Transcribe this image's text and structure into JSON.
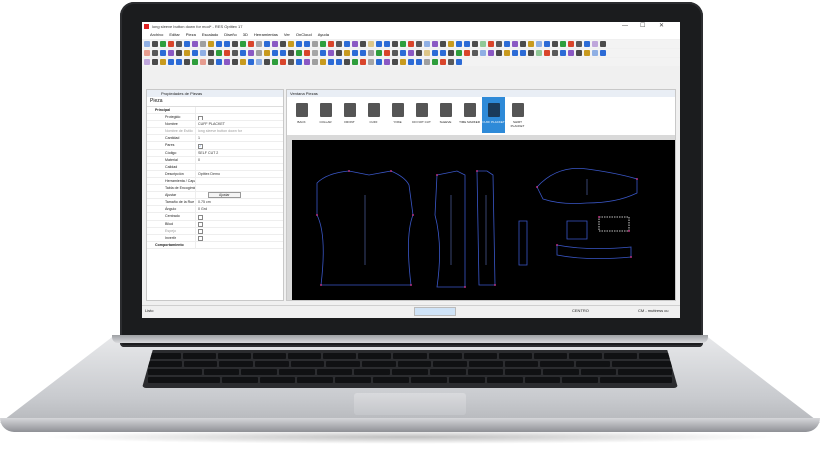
{
  "window": {
    "title": "long sleeve button down for mod* - RES Optitex 17",
    "controls": [
      "—",
      "☐",
      "✕"
    ]
  },
  "menu": [
    "Archivo",
    "Editar",
    "Pieza",
    "Escalado",
    "Diseño",
    "3D",
    "Herramientas",
    "Ver",
    "OnCloud",
    "Ayuda"
  ],
  "left_panel": {
    "title": "Propiedades de Piezas",
    "subtitle": "Pieza",
    "properties": [
      {
        "k": "Principal",
        "v": "",
        "section": true
      },
      {
        "k": "Protegido",
        "v": "",
        "type": "check"
      },
      {
        "k": "Nombre",
        "v": "CUFF PLACKET"
      },
      {
        "k": "Nombre de Estilo",
        "v": "long sleeve button down for",
        "grey": true
      },
      {
        "k": "Cantidad",
        "v": "1"
      },
      {
        "k": "Pares",
        "v": "✓",
        "type": "check"
      },
      {
        "k": "Código",
        "v": "SELF CUT 2"
      },
      {
        "k": "Material",
        "v": "0"
      },
      {
        "k": "Calidad",
        "v": ""
      },
      {
        "k": "Descripción",
        "v": "Optitex Demo"
      },
      {
        "k": "Herramienta / Capa",
        "v": ""
      },
      {
        "k": "Tabla de Encogimiento",
        "v": ""
      },
      {
        "k": "Ajustar",
        "v": "Ajustar",
        "type": "button"
      },
      {
        "k": "Tamaño de la Rue",
        "v": "0.75 cm"
      },
      {
        "k": "Ángulo",
        "v": "0 Grd"
      },
      {
        "k": "Centrado",
        "v": "",
        "type": "check"
      },
      {
        "k": "Bilud",
        "v": "",
        "type": "check"
      },
      {
        "k": "Espejo",
        "v": "",
        "type": "check",
        "grey": true
      },
      {
        "k": "Invertir",
        "v": "",
        "type": "check"
      },
      {
        "k": "Comportamiento",
        "v": "",
        "section": true
      }
    ]
  },
  "right_panel": {
    "title": "Ventana Piezas",
    "pieces": [
      {
        "label": "BACK"
      },
      {
        "label": "COLLAR"
      },
      {
        "label": "FRONT"
      },
      {
        "label": "CUFF"
      },
      {
        "label": "YOKE"
      },
      {
        "label": "DO NOT CUT"
      },
      {
        "label": "SLEEVE"
      },
      {
        "label": "TIME MARKER"
      },
      {
        "label": "CUFF PLACKET",
        "selected": true
      },
      {
        "label": "SHIRT PLACKET"
      }
    ]
  },
  "statusbar": {
    "left": "Listo",
    "mid": "CENTRO",
    "right": "CM - muttress cu"
  },
  "colors": {
    "canvas_bg": "#000000",
    "pattern_line": "#3a57c8",
    "notch": "#e2399a",
    "selected": "#2e8ad8"
  }
}
